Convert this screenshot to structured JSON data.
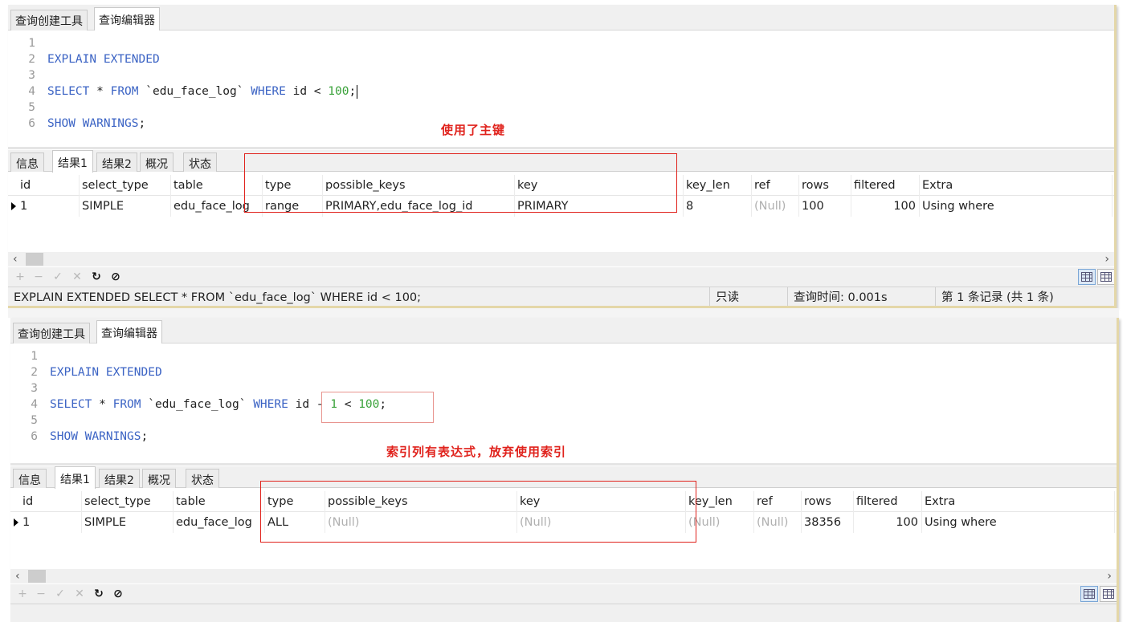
{
  "panels": [
    {
      "top_tabs": [
        "查询创建工具",
        "查询编辑器"
      ],
      "code_lines": [
        {
          "n": "1",
          "tokens": []
        },
        {
          "n": "2",
          "tokens": [
            {
              "t": "EXPLAIN EXTENDED",
              "c": "kw"
            }
          ]
        },
        {
          "n": "3",
          "tokens": []
        },
        {
          "n": "4",
          "tokens": [
            {
              "t": "SELECT",
              "c": "kw"
            },
            {
              "t": " * ",
              "c": "plain"
            },
            {
              "t": "FROM",
              "c": "kw"
            },
            {
              "t": " `edu_face_log` ",
              "c": "plain"
            },
            {
              "t": "WHERE",
              "c": "kw"
            },
            {
              "t": " id < ",
              "c": "plain"
            },
            {
              "t": "100",
              "c": "num"
            },
            {
              "t": ";",
              "c": "plain"
            }
          ]
        },
        {
          "n": "5",
          "tokens": []
        },
        {
          "n": "6",
          "tokens": [
            {
              "t": "SHOW WARNINGS",
              "c": "kw"
            },
            {
              "t": ";",
              "c": "plain"
            }
          ]
        }
      ],
      "annotation": "使用了主键",
      "result_tabs": [
        "信息",
        "结果1",
        "结果2",
        "概况",
        "状态"
      ],
      "columns": [
        "id",
        "select_type",
        "table",
        "type",
        "possible_keys",
        "key",
        "key_len",
        "ref",
        "rows",
        "filtered",
        "Extra"
      ],
      "row": [
        "1",
        "SIMPLE",
        "edu_face_log",
        "range",
        "PRIMARY,edu_face_log_id",
        "PRIMARY",
        "8",
        "(Null)",
        "100",
        "100",
        "Using where"
      ],
      "status": {
        "sql": "EXPLAIN EXTENDED  SELECT * FROM `edu_face_log` WHERE id < 100;",
        "mode": "只读",
        "time": "查询时间: 0.001s",
        "records": "第 1 条记录 (共 1 条)"
      }
    },
    {
      "top_tabs": [
        "查询创建工具",
        "查询编辑器"
      ],
      "code_lines": [
        {
          "n": "1",
          "tokens": []
        },
        {
          "n": "2",
          "tokens": [
            {
              "t": "EXPLAIN EXTENDED",
              "c": "kw"
            }
          ]
        },
        {
          "n": "3",
          "tokens": []
        },
        {
          "n": "4",
          "tokens": [
            {
              "t": "SELECT",
              "c": "kw"
            },
            {
              "t": " * ",
              "c": "plain"
            },
            {
              "t": "FROM",
              "c": "kw"
            },
            {
              "t": " `edu_face_log` ",
              "c": "plain"
            },
            {
              "t": "WHERE",
              "c": "kw"
            },
            {
              "t": " id - ",
              "c": "plain"
            },
            {
              "t": "1",
              "c": "num"
            },
            {
              "t": " < ",
              "c": "plain"
            },
            {
              "t": "100",
              "c": "num"
            },
            {
              "t": ";",
              "c": "plain"
            }
          ]
        },
        {
          "n": "5",
          "tokens": []
        },
        {
          "n": "6",
          "tokens": [
            {
              "t": "SHOW WARNINGS",
              "c": "kw"
            },
            {
              "t": ";",
              "c": "plain"
            }
          ]
        }
      ],
      "annotation": "索引列有表达式，放弃使用索引",
      "result_tabs": [
        "信息",
        "结果1",
        "结果2",
        "概况",
        "状态"
      ],
      "columns": [
        "id",
        "select_type",
        "table",
        "type",
        "possible_keys",
        "key",
        "key_len",
        "ref",
        "rows",
        "filtered",
        "Extra"
      ],
      "row": [
        "1",
        "SIMPLE",
        "edu_face_log",
        "ALL",
        "(Null)",
        "(Null)",
        "(Null)",
        "(Null)",
        "38356",
        "100",
        "Using where"
      ]
    }
  ],
  "colors": {
    "keyword": "#3b63c4",
    "number": "#3aa23a",
    "annotation": "#e0221c",
    "null": "#b0b0b0"
  }
}
